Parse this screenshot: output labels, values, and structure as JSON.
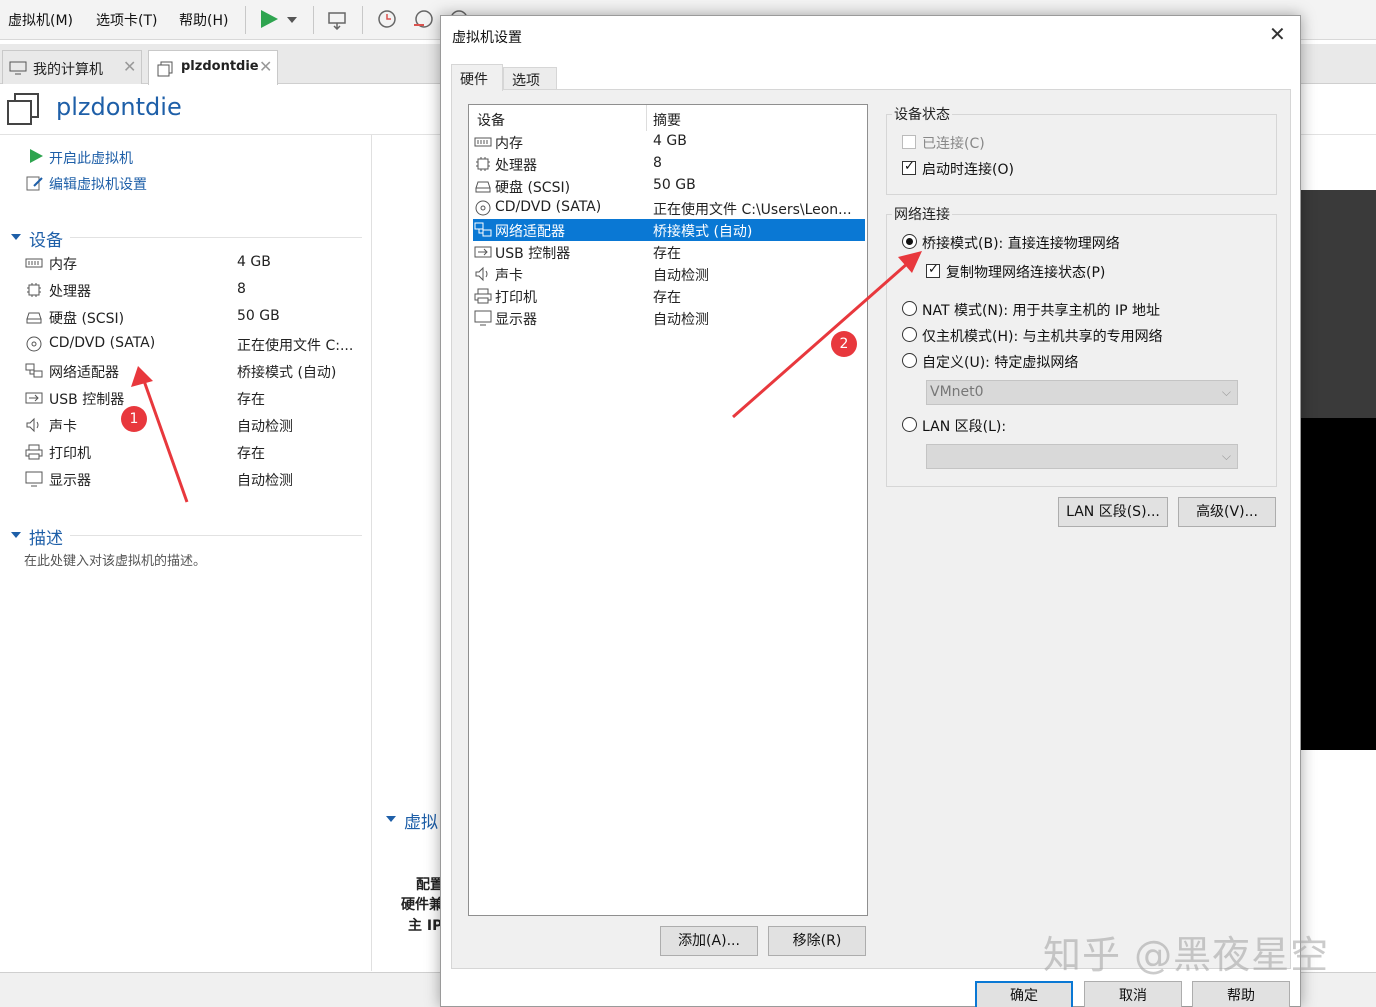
{
  "menu": {
    "vm": "虚拟机(M)",
    "tabs": "选项卡(T)",
    "help": "帮助(H)"
  },
  "tabs": [
    {
      "label": "我的计算机"
    },
    {
      "label": "plzdontdie"
    }
  ],
  "vm": {
    "title": "plzdontdie",
    "actions": {
      "power_on": "开启此虚拟机",
      "edit_settings": "编辑虚拟机设置"
    },
    "devices_header": "设备",
    "devices": [
      {
        "name": "内存",
        "summary": "4 GB",
        "icon": "memory-icon"
      },
      {
        "name": "处理器",
        "summary": "8",
        "icon": "cpu-icon"
      },
      {
        "name": "硬盘 (SCSI)",
        "summary": "50 GB",
        "icon": "harddisk-icon"
      },
      {
        "name": "CD/DVD (SATA)",
        "summary": "正在使用文件 C:...",
        "icon": "cdrom-icon"
      },
      {
        "name": "网络适配器",
        "summary": "桥接模式 (自动)",
        "icon": "network-icon"
      },
      {
        "name": "USB 控制器",
        "summary": "存在",
        "icon": "usb-icon"
      },
      {
        "name": "声卡",
        "summary": "自动检测",
        "icon": "sound-icon"
      },
      {
        "name": "打印机",
        "summary": "存在",
        "icon": "printer-icon"
      },
      {
        "name": "显示器",
        "summary": "自动检测",
        "icon": "display-icon"
      }
    ],
    "description_header": "描述",
    "description_placeholder": "在此处键入对该虚拟机的描述。",
    "details_header": "虚拟",
    "details_lines": [
      "配置",
      "硬件兼",
      "主 IP"
    ]
  },
  "dialog": {
    "title": "虚拟机设置",
    "tabs": {
      "hardware": "硬件",
      "options": "选项"
    },
    "list_headers": {
      "device": "设备",
      "summary": "摘要"
    },
    "devices": [
      {
        "name": "内存",
        "summary": "4 GB",
        "icon": "memory-icon"
      },
      {
        "name": "处理器",
        "summary": "8",
        "icon": "cpu-icon"
      },
      {
        "name": "硬盘 (SCSI)",
        "summary": "50 GB",
        "icon": "harddisk-icon"
      },
      {
        "name": "CD/DVD (SATA)",
        "summary": "正在使用文件 C:\\Users\\Leon...",
        "icon": "cdrom-icon"
      },
      {
        "name": "网络适配器",
        "summary": "桥接模式 (自动)",
        "icon": "network-icon",
        "selected": true
      },
      {
        "name": "USB 控制器",
        "summary": "存在",
        "icon": "usb-icon"
      },
      {
        "name": "声卡",
        "summary": "自动检测",
        "icon": "sound-icon"
      },
      {
        "name": "打印机",
        "summary": "存在",
        "icon": "printer-icon"
      },
      {
        "name": "显示器",
        "summary": "自动检测",
        "icon": "display-icon"
      }
    ],
    "add_button": "添加(A)...",
    "remove_button": "移除(R)",
    "device_status": {
      "title": "设备状态",
      "connected": {
        "label": "已连接(C)",
        "checked": false,
        "disabled": true
      },
      "connect_at_power_on": {
        "label": "启动时连接(O)",
        "checked": true
      }
    },
    "network": {
      "title": "网络连接",
      "bridged": {
        "label": "桥接模式(B): 直接连接物理网络",
        "selected": true
      },
      "replicate": {
        "label": "复制物理网络连接状态(P)",
        "checked": true
      },
      "nat": {
        "label": "NAT 模式(N): 用于共享主机的 IP 地址",
        "selected": false
      },
      "host_only": {
        "label": "仅主机模式(H): 与主机共享的专用网络",
        "selected": false
      },
      "custom": {
        "label": "自定义(U): 特定虚拟网络",
        "selected": false
      },
      "custom_select_value": "VMnet0",
      "lan_segment": {
        "label": "LAN 区段(L):",
        "selected": false
      },
      "lan_segment_value": ""
    },
    "lan_segments_button": "LAN 区段(S)...",
    "advanced_button": "高级(V)...",
    "footer": {
      "ok": "确定",
      "cancel": "取消",
      "help": "帮助"
    }
  },
  "annotations": {
    "marker1": "1",
    "marker2": "2"
  },
  "watermark": "知乎 @黑夜星空",
  "colors": {
    "accent": "#0a78d4",
    "link": "#1e5fa8",
    "annotation": "#e8383d",
    "play": "#2ea44f"
  }
}
